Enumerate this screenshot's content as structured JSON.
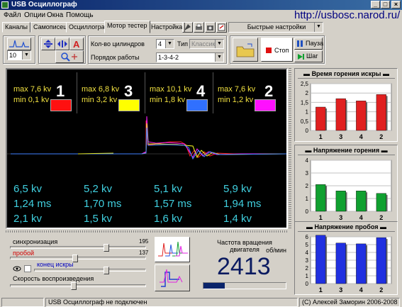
{
  "window": {
    "title": "USB Осциллограф",
    "min": "_",
    "max": "□",
    "close": "×"
  },
  "menu": [
    "Файл",
    "Опции",
    "Окна",
    "Помощь"
  ],
  "url": "http://usbosc.narod.ru/",
  "tabs": [
    {
      "label": "Каналы",
      "active": false
    },
    {
      "label": "Самописец",
      "active": false
    },
    {
      "label": "Осциллограф",
      "active": false
    },
    {
      "label": "Мотор тестер",
      "active": true
    },
    {
      "label": "Настройка",
      "active": false
    }
  ],
  "quick_settings": "Быстрые настройки",
  "toolbar": {
    "zoom_value": "10"
  },
  "engine": {
    "cylinders_label": "Кол-во цилиндров",
    "cylinders_value": "4",
    "type_label": "Тип",
    "type_value": "Классика",
    "order_label": "Порядок работы",
    "order_value": "1-3-4-2"
  },
  "controls": {
    "stop": "Стоп",
    "pause": "Пауза",
    "step": "Шаг"
  },
  "cylinders": [
    {
      "num": "1",
      "max": "max 7,6 kv",
      "min": "min 0,1 kv",
      "color": "#ff1010",
      "voltage": "6,5 kv",
      "time": "1,24 ms",
      "breakdown": "2,1 kv"
    },
    {
      "num": "3",
      "max": "max 6,8 kv",
      "min": "min 3,2 kv",
      "color": "#ffff00",
      "voltage": "5,2 kv",
      "time": "1,70 ms",
      "breakdown": "1,5 kv"
    },
    {
      "num": "4",
      "max": "max 10,1 kv",
      "min": "min 1,8 kv",
      "color": "#3070ff",
      "voltage": "5,1 kv",
      "time": "1,57 ms",
      "breakdown": "1,6 kv"
    },
    {
      "num": "2",
      "max": "max 7,6 kv",
      "min": "min 1,2 kv",
      "color": "#ff10ff",
      "voltage": "5,9 kv",
      "time": "1,94 ms",
      "breakdown": "1,4 kv"
    }
  ],
  "bottom": {
    "sync_label": "синхронизация",
    "sync_value": "195",
    "breakdown_label": "пробой",
    "breakdown_value": "137",
    "spark_end_label": "конец искры",
    "speed_label": "Скорость воспроизведения",
    "rpm_label": "Частота вращения двигателя",
    "rpm_unit": "об/мин",
    "rpm_value": "2413"
  },
  "chart_data": [
    {
      "type": "bar",
      "title": "Время горения искры",
      "categories": [
        "1",
        "3",
        "4",
        "2"
      ],
      "values": [
        1.25,
        1.7,
        1.58,
        1.92
      ],
      "ylim": [
        0,
        2.5
      ],
      "yticks": [
        "0",
        "0,5",
        "1",
        "1,5",
        "2",
        "2,5"
      ],
      "color": "#e02020",
      "grid": true
    },
    {
      "type": "bar",
      "title": "Напряжение горения",
      "categories": [
        "1",
        "3",
        "4",
        "2"
      ],
      "values": [
        2.1,
        1.6,
        1.6,
        1.4
      ],
      "ylim": [
        0,
        4
      ],
      "yticks": [
        "0",
        "1",
        "2",
        "3",
        "4"
      ],
      "color": "#10a030",
      "grid": true
    },
    {
      "type": "bar",
      "title": "Напряжение пробоя",
      "categories": [
        "1",
        "3",
        "4",
        "2"
      ],
      "values": [
        6.2,
        5.2,
        5.1,
        5.9
      ],
      "ylim": [
        0,
        6
      ],
      "yticks": [
        "0",
        "1",
        "2",
        "3",
        "4",
        "5",
        "6"
      ],
      "color": "#2030e0",
      "grid": true
    }
  ],
  "status": {
    "connection": "USB Осциллограф не подключен",
    "copyright": "(C) Алексей Заморин 2006-2008"
  }
}
